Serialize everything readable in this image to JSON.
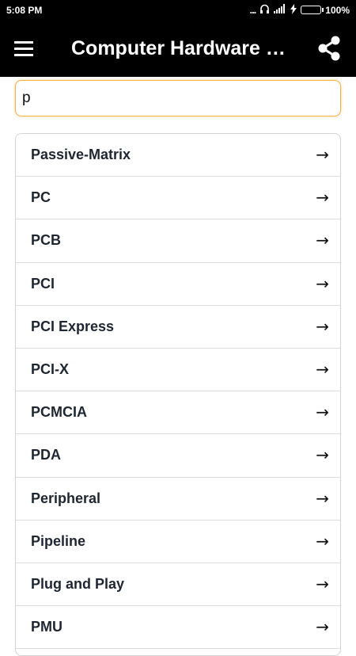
{
  "status_bar": {
    "time": "5:08 PM",
    "signal_dots": "...",
    "battery_percent": "100%",
    "battery_level": 1.0
  },
  "app_bar": {
    "title": "Computer Hardware Di…",
    "menu_icon": "hamburger-menu-icon",
    "share_icon": "share-icon"
  },
  "search": {
    "value": "p"
  },
  "list": {
    "arrow_glyph": "→",
    "items": [
      {
        "label": "Passive-Matrix"
      },
      {
        "label": "PC"
      },
      {
        "label": "PCB"
      },
      {
        "label": "PCI"
      },
      {
        "label": "PCI Express"
      },
      {
        "label": "PCI-X"
      },
      {
        "label": "PCMCIA"
      },
      {
        "label": "PDA"
      },
      {
        "label": "Peripheral"
      },
      {
        "label": "Pipeline"
      },
      {
        "label": "Plug and Play"
      },
      {
        "label": "PMU"
      }
    ]
  },
  "colors": {
    "app_bar_bg": "#000000",
    "search_border": "#f2b34d",
    "battery_fill": "#39d353",
    "item_text": "#1f2630"
  }
}
